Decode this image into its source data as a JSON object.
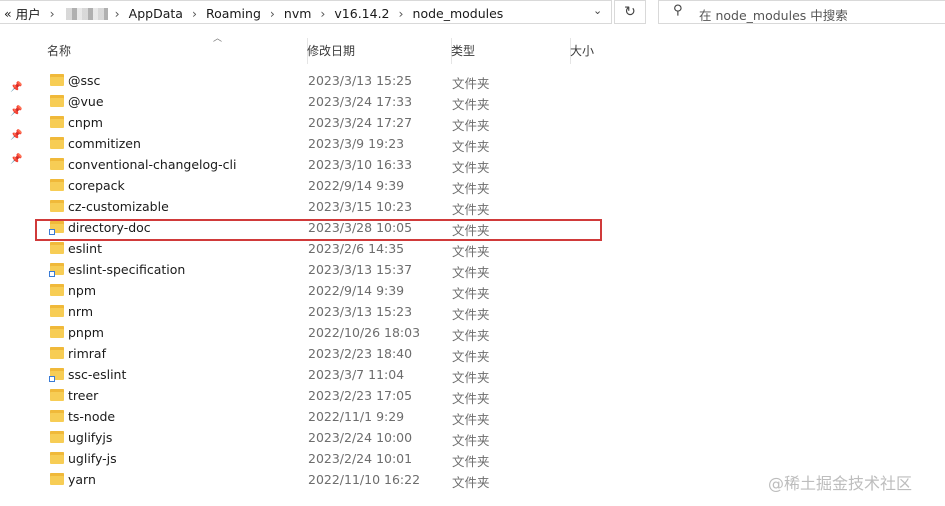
{
  "breadcrumb": {
    "prefix": "«",
    "items": [
      "用户",
      "AppData",
      "Roaming",
      "nvm",
      "v16.14.2",
      "node_modules"
    ]
  },
  "search": {
    "placeholder": "在 node_modules 中搜索"
  },
  "columns": {
    "name": "名称",
    "date": "修改日期",
    "type": "类型",
    "size": "大小"
  },
  "files": [
    {
      "name": "@ssc",
      "date": "2023/3/13 15:25",
      "type": "文件夹",
      "shortcut": false
    },
    {
      "name": "@vue",
      "date": "2023/3/24 17:33",
      "type": "文件夹",
      "shortcut": false
    },
    {
      "name": "cnpm",
      "date": "2023/3/24 17:27",
      "type": "文件夹",
      "shortcut": false
    },
    {
      "name": "commitizen",
      "date": "2023/3/9 19:23",
      "type": "文件夹",
      "shortcut": false
    },
    {
      "name": "conventional-changelog-cli",
      "date": "2023/3/10 16:33",
      "type": "文件夹",
      "shortcut": false
    },
    {
      "name": "corepack",
      "date": "2022/9/14 9:39",
      "type": "文件夹",
      "shortcut": false
    },
    {
      "name": "cz-customizable",
      "date": "2023/3/15 10:23",
      "type": "文件夹",
      "shortcut": false
    },
    {
      "name": "directory-doc",
      "date": "2023/3/28 10:05",
      "type": "文件夹",
      "shortcut": true
    },
    {
      "name": "eslint",
      "date": "2023/2/6 14:35",
      "type": "文件夹",
      "shortcut": false
    },
    {
      "name": "eslint-specification",
      "date": "2023/3/13 15:37",
      "type": "文件夹",
      "shortcut": true
    },
    {
      "name": "npm",
      "date": "2022/9/14 9:39",
      "type": "文件夹",
      "shortcut": false
    },
    {
      "name": "nrm",
      "date": "2023/3/13 15:23",
      "type": "文件夹",
      "shortcut": false
    },
    {
      "name": "pnpm",
      "date": "2022/10/26 18:03",
      "type": "文件夹",
      "shortcut": false
    },
    {
      "name": "rimraf",
      "date": "2023/2/23 18:40",
      "type": "文件夹",
      "shortcut": false
    },
    {
      "name": "ssc-eslint",
      "date": "2023/3/7 11:04",
      "type": "文件夹",
      "shortcut": true
    },
    {
      "name": "treer",
      "date": "2023/2/23 17:05",
      "type": "文件夹",
      "shortcut": false
    },
    {
      "name": "ts-node",
      "date": "2022/11/1 9:29",
      "type": "文件夹",
      "shortcut": false
    },
    {
      "name": "uglifyjs",
      "date": "2023/2/24 10:00",
      "type": "文件夹",
      "shortcut": false
    },
    {
      "name": "uglify-js",
      "date": "2023/2/24 10:01",
      "type": "文件夹",
      "shortcut": false
    },
    {
      "name": "yarn",
      "date": "2022/11/10 16:22",
      "type": "文件夹",
      "shortcut": false
    }
  ],
  "watermark": "@稀土掘金技术社区"
}
